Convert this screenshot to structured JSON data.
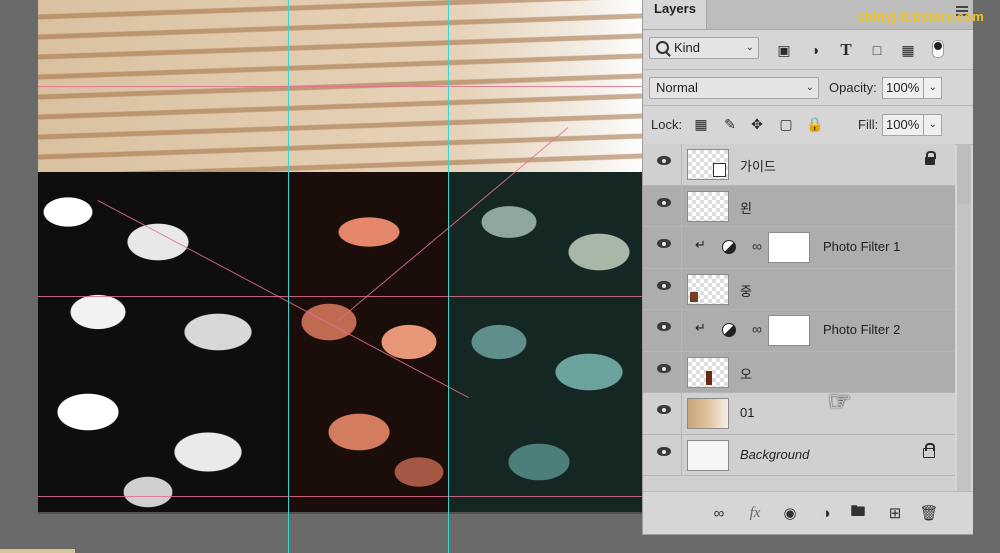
{
  "watermark": "shinyj-it.tistory.com",
  "panel": {
    "tab_label": "Layers",
    "filter_kind": "Kind",
    "blend_mode": "Normal",
    "opacity_label": "Opacity:",
    "opacity_value": "100%",
    "lock_label": "Lock:",
    "fill_label": "Fill:",
    "fill_value": "100%"
  },
  "layers": [
    {
      "name": "가이드",
      "type": "smart-object",
      "selected": false,
      "locked": true
    },
    {
      "name": "왼",
      "type": "pixel",
      "selected": true
    },
    {
      "name": "Photo Filter 1",
      "type": "adjustment",
      "selected": true,
      "clipped": true
    },
    {
      "name": "중",
      "type": "pixel",
      "selected": true
    },
    {
      "name": "Photo Filter 2",
      "type": "adjustment",
      "selected": true,
      "clipped": true
    },
    {
      "name": "오",
      "type": "pixel",
      "selected": true
    },
    {
      "name": "01",
      "type": "pixel",
      "selected": false
    },
    {
      "name": "Background",
      "type": "background",
      "selected": false,
      "locked": true
    }
  ],
  "icons": {
    "filter": [
      "image-filter-icon",
      "adjustment-filter-icon",
      "type-filter-icon",
      "shape-filter-icon",
      "smart-filter-icon"
    ],
    "lock": [
      "lock-pixels-icon",
      "lock-image-icon",
      "lock-position-icon",
      "lock-artboard-icon",
      "lock-all-icon"
    ],
    "footer": [
      "link-icon",
      "fx-icon",
      "mask-icon",
      "adjustment-icon",
      "folder-icon",
      "new-layer-icon",
      "trash-icon"
    ]
  },
  "colors": {
    "guide": "#3cd3d3",
    "watermark": "#f0c020",
    "panel_bg": "#d6d6d6",
    "selected_layer": "#adadad"
  }
}
